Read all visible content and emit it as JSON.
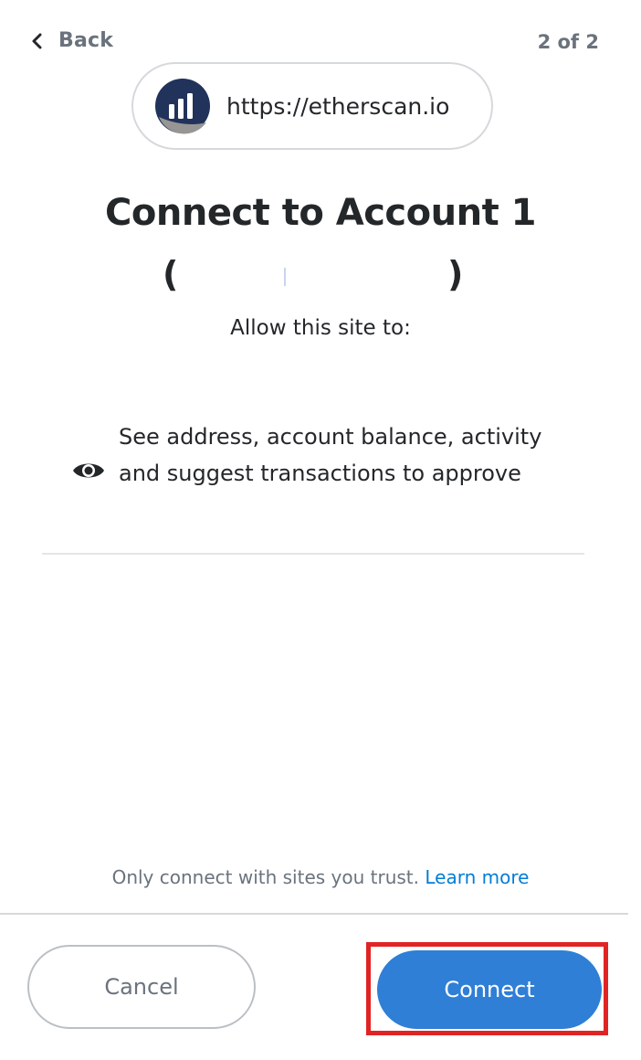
{
  "header": {
    "back_label": "Back",
    "back_icon": "chevron-left-icon",
    "step_indicator": "2 of 2"
  },
  "site": {
    "url": "https://etherscan.io",
    "logo_icon": "etherscan-logo-icon"
  },
  "title": "Connect to Account 1",
  "account": {
    "open_paren": "(",
    "close_paren": ")"
  },
  "subtitle": "Allow this site to:",
  "permission": {
    "icon": "eye-icon",
    "text": "See address, account balance, activity and suggest transactions to approve"
  },
  "footer": {
    "trust_text": "Only connect with sites you trust.",
    "learn_more": "Learn more",
    "cancel_label": "Cancel",
    "connect_label": "Connect"
  },
  "colors": {
    "primary": "#2f7fd6",
    "link": "#037dd6",
    "highlight": "#e02424",
    "text": "#24272a",
    "muted": "#6a737d"
  }
}
